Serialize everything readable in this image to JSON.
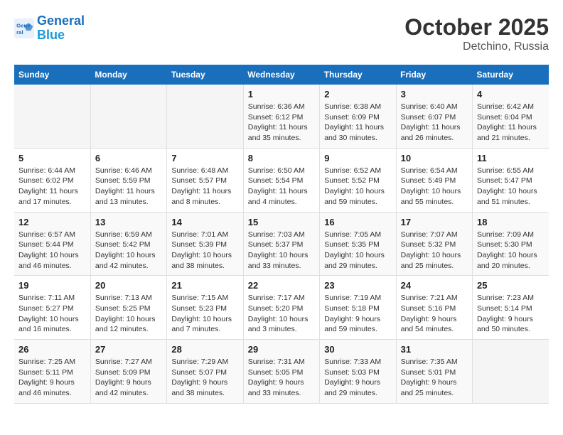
{
  "logo": {
    "line1": "General",
    "line2": "Blue"
  },
  "title": "October 2025",
  "subtitle": "Detchino, Russia",
  "headers": [
    "Sunday",
    "Monday",
    "Tuesday",
    "Wednesday",
    "Thursday",
    "Friday",
    "Saturday"
  ],
  "weeks": [
    {
      "days": [
        {
          "num": "",
          "info": ""
        },
        {
          "num": "",
          "info": ""
        },
        {
          "num": "",
          "info": ""
        },
        {
          "num": "1",
          "info": "Sunrise: 6:36 AM\nSunset: 6:12 PM\nDaylight: 11 hours\nand 35 minutes."
        },
        {
          "num": "2",
          "info": "Sunrise: 6:38 AM\nSunset: 6:09 PM\nDaylight: 11 hours\nand 30 minutes."
        },
        {
          "num": "3",
          "info": "Sunrise: 6:40 AM\nSunset: 6:07 PM\nDaylight: 11 hours\nand 26 minutes."
        },
        {
          "num": "4",
          "info": "Sunrise: 6:42 AM\nSunset: 6:04 PM\nDaylight: 11 hours\nand 21 minutes."
        }
      ]
    },
    {
      "days": [
        {
          "num": "5",
          "info": "Sunrise: 6:44 AM\nSunset: 6:02 PM\nDaylight: 11 hours\nand 17 minutes."
        },
        {
          "num": "6",
          "info": "Sunrise: 6:46 AM\nSunset: 5:59 PM\nDaylight: 11 hours\nand 13 minutes."
        },
        {
          "num": "7",
          "info": "Sunrise: 6:48 AM\nSunset: 5:57 PM\nDaylight: 11 hours\nand 8 minutes."
        },
        {
          "num": "8",
          "info": "Sunrise: 6:50 AM\nSunset: 5:54 PM\nDaylight: 11 hours\nand 4 minutes."
        },
        {
          "num": "9",
          "info": "Sunrise: 6:52 AM\nSunset: 5:52 PM\nDaylight: 10 hours\nand 59 minutes."
        },
        {
          "num": "10",
          "info": "Sunrise: 6:54 AM\nSunset: 5:49 PM\nDaylight: 10 hours\nand 55 minutes."
        },
        {
          "num": "11",
          "info": "Sunrise: 6:55 AM\nSunset: 5:47 PM\nDaylight: 10 hours\nand 51 minutes."
        }
      ]
    },
    {
      "days": [
        {
          "num": "12",
          "info": "Sunrise: 6:57 AM\nSunset: 5:44 PM\nDaylight: 10 hours\nand 46 minutes."
        },
        {
          "num": "13",
          "info": "Sunrise: 6:59 AM\nSunset: 5:42 PM\nDaylight: 10 hours\nand 42 minutes."
        },
        {
          "num": "14",
          "info": "Sunrise: 7:01 AM\nSunset: 5:39 PM\nDaylight: 10 hours\nand 38 minutes."
        },
        {
          "num": "15",
          "info": "Sunrise: 7:03 AM\nSunset: 5:37 PM\nDaylight: 10 hours\nand 33 minutes."
        },
        {
          "num": "16",
          "info": "Sunrise: 7:05 AM\nSunset: 5:35 PM\nDaylight: 10 hours\nand 29 minutes."
        },
        {
          "num": "17",
          "info": "Sunrise: 7:07 AM\nSunset: 5:32 PM\nDaylight: 10 hours\nand 25 minutes."
        },
        {
          "num": "18",
          "info": "Sunrise: 7:09 AM\nSunset: 5:30 PM\nDaylight: 10 hours\nand 20 minutes."
        }
      ]
    },
    {
      "days": [
        {
          "num": "19",
          "info": "Sunrise: 7:11 AM\nSunset: 5:27 PM\nDaylight: 10 hours\nand 16 minutes."
        },
        {
          "num": "20",
          "info": "Sunrise: 7:13 AM\nSunset: 5:25 PM\nDaylight: 10 hours\nand 12 minutes."
        },
        {
          "num": "21",
          "info": "Sunrise: 7:15 AM\nSunset: 5:23 PM\nDaylight: 10 hours\nand 7 minutes."
        },
        {
          "num": "22",
          "info": "Sunrise: 7:17 AM\nSunset: 5:20 PM\nDaylight: 10 hours\nand 3 minutes."
        },
        {
          "num": "23",
          "info": "Sunrise: 7:19 AM\nSunset: 5:18 PM\nDaylight: 9 hours\nand 59 minutes."
        },
        {
          "num": "24",
          "info": "Sunrise: 7:21 AM\nSunset: 5:16 PM\nDaylight: 9 hours\nand 54 minutes."
        },
        {
          "num": "25",
          "info": "Sunrise: 7:23 AM\nSunset: 5:14 PM\nDaylight: 9 hours\nand 50 minutes."
        }
      ]
    },
    {
      "days": [
        {
          "num": "26",
          "info": "Sunrise: 7:25 AM\nSunset: 5:11 PM\nDaylight: 9 hours\nand 46 minutes."
        },
        {
          "num": "27",
          "info": "Sunrise: 7:27 AM\nSunset: 5:09 PM\nDaylight: 9 hours\nand 42 minutes."
        },
        {
          "num": "28",
          "info": "Sunrise: 7:29 AM\nSunset: 5:07 PM\nDaylight: 9 hours\nand 38 minutes."
        },
        {
          "num": "29",
          "info": "Sunrise: 7:31 AM\nSunset: 5:05 PM\nDaylight: 9 hours\nand 33 minutes."
        },
        {
          "num": "30",
          "info": "Sunrise: 7:33 AM\nSunset: 5:03 PM\nDaylight: 9 hours\nand 29 minutes."
        },
        {
          "num": "31",
          "info": "Sunrise: 7:35 AM\nSunset: 5:01 PM\nDaylight: 9 hours\nand 25 minutes."
        },
        {
          "num": "",
          "info": ""
        }
      ]
    }
  ]
}
